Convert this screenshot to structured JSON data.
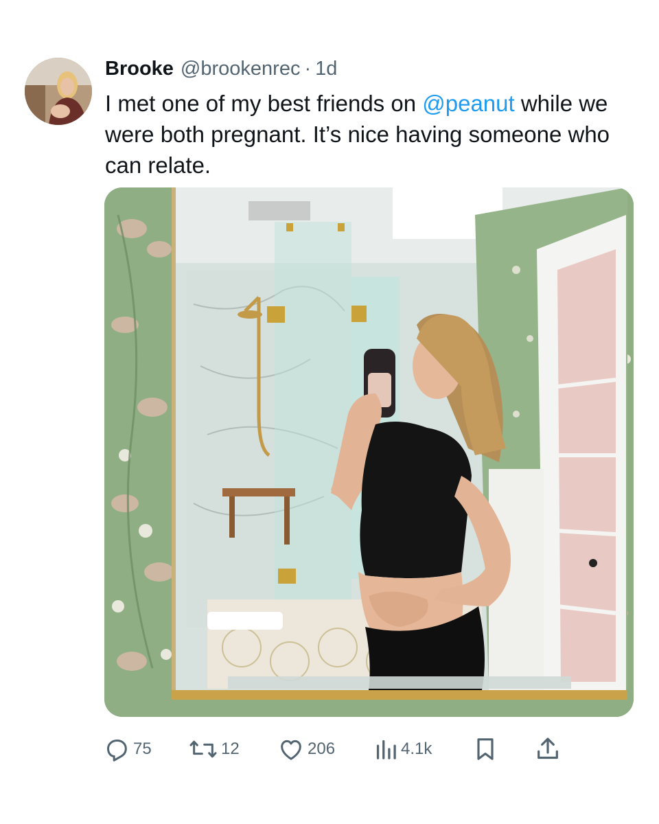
{
  "tweet": {
    "author_name": "Brooke",
    "handle": "@brookenrec",
    "separator": "·",
    "time": "1d",
    "text_before": "I met one of my best friends on ",
    "mention": "@peanut",
    "text_after": " while we were both pregnant. It’s nice having someone who can relate."
  },
  "actions": {
    "replies": "75",
    "reposts": "12",
    "likes": "206",
    "views": "4.1k"
  },
  "icons": {
    "reply": "reply-icon",
    "repost": "repost-icon",
    "like": "heart-icon",
    "views": "views-icon",
    "bookmark": "bookmark-icon",
    "share": "share-icon"
  },
  "colors": {
    "text": "#0f1419",
    "secondary": "#536471",
    "link": "#1d9bf0",
    "wallpaper_green": "#8fae84"
  }
}
